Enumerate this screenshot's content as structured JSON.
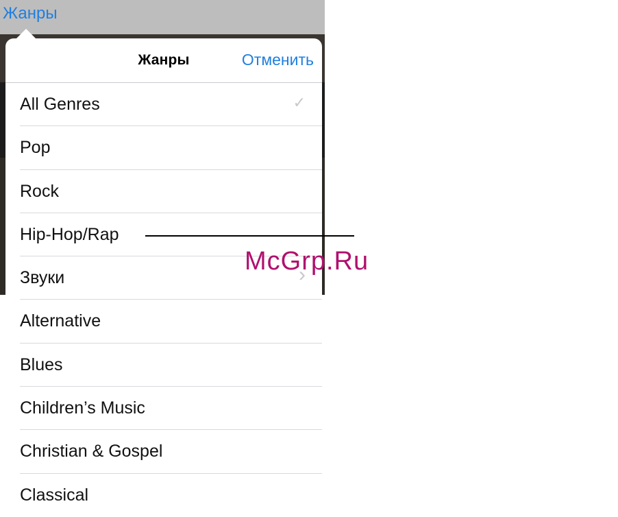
{
  "topbar": {
    "genres_link": "Жанры"
  },
  "popover": {
    "title": "Жанры",
    "cancel_label": "Отменить",
    "items": [
      {
        "label": "All Genres",
        "accessory": "checkmark-icon",
        "accessory_glyph": "✓"
      },
      {
        "label": "Pop"
      },
      {
        "label": "Rock"
      },
      {
        "label": "Hip-Hop/Rap"
      },
      {
        "label": "Звуки",
        "accessory": "chevron-right-icon",
        "accessory_glyph": "›"
      },
      {
        "label": "Alternative"
      },
      {
        "label": "Blues"
      },
      {
        "label": "Children’s Music"
      },
      {
        "label": "Christian & Gospel"
      },
      {
        "label": "Classical"
      }
    ]
  },
  "watermark": "McGrp.Ru",
  "colors": {
    "accent": "#1f7fe0",
    "watermark": "#b0106e",
    "separator": "#d9d9de"
  }
}
